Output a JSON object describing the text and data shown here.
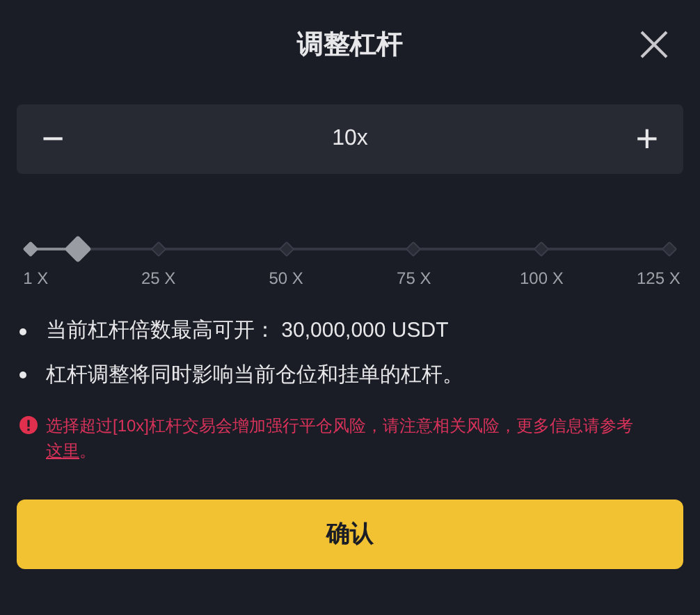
{
  "title": "调整杠杆",
  "stepper": {
    "minus": "−",
    "value": "10x",
    "plus": "+"
  },
  "slider": {
    "level": 0.073,
    "ticks": [
      "1 X",
      "25 X",
      "50 X",
      "75 X",
      "100 X",
      "125 X"
    ]
  },
  "bullets": [
    "当前杠杆倍数最高可开： 30,000,000 USDT",
    "杠杆调整将同时影响当前仓位和挂单的杠杆。"
  ],
  "warning": {
    "text": "选择超过[10x]杠杆交易会增加强行平仓风险，请注意相关风险，更多信息请参考",
    "link": "这里",
    "end": "。"
  },
  "confirm": "确认"
}
